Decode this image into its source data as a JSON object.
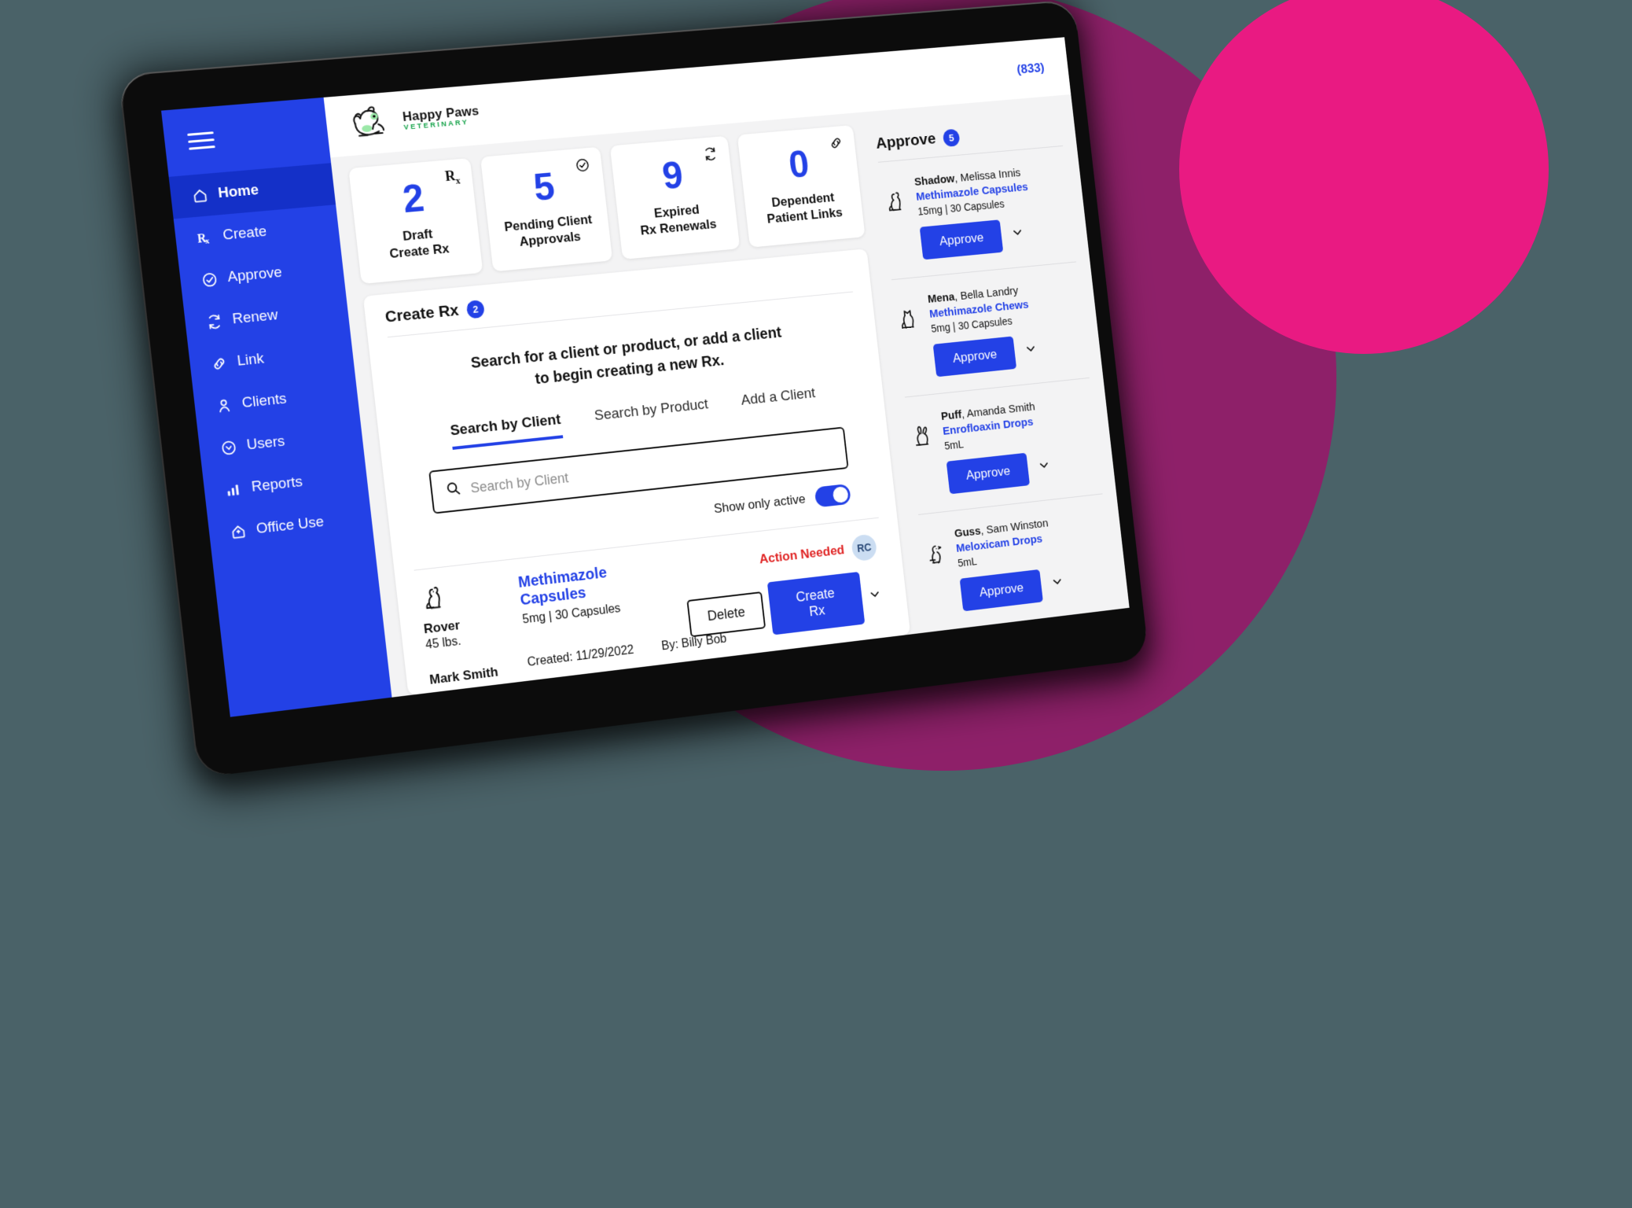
{
  "background": {
    "circle_purple": "#8E2069",
    "circle_pink": "#E91A82",
    "canvas": "#4A6268"
  },
  "brand": {
    "accent": "#2341E6",
    "name": "Happy Paws",
    "sub": "VETERINARY"
  },
  "topbar": {
    "phone": "(833)"
  },
  "sidebar": {
    "menu_icon": "hamburger-icon",
    "items": [
      {
        "label": "Home",
        "icon": "home-icon",
        "active": true
      },
      {
        "label": "Create",
        "icon": "rx-icon",
        "active": false
      },
      {
        "label": "Approve",
        "icon": "check-circle-icon",
        "active": false
      },
      {
        "label": "Renew",
        "icon": "refresh-icon",
        "active": false
      },
      {
        "label": "Link",
        "icon": "link-icon",
        "active": false
      },
      {
        "label": "Clients",
        "icon": "person-icon",
        "active": false
      },
      {
        "label": "Users",
        "icon": "user-circle-icon",
        "active": false
      },
      {
        "label": "Reports",
        "icon": "bar-chart-icon",
        "active": false
      },
      {
        "label": "Office Use",
        "icon": "office-icon",
        "active": false
      }
    ]
  },
  "stats": [
    {
      "value": "2",
      "label_1": "Draft",
      "label_2": "Create Rx",
      "icon": "rx-icon"
    },
    {
      "value": "5",
      "label_1": "Pending Client",
      "label_2": "Approvals",
      "icon": "check-circle-icon"
    },
    {
      "value": "9",
      "label_1": "Expired",
      "label_2": "Rx Renewals",
      "icon": "refresh-icon"
    },
    {
      "value": "0",
      "label_1": "Dependent",
      "label_2": "Patient Links",
      "icon": "link-icon"
    }
  ],
  "create_rx": {
    "title": "Create Rx",
    "count": "2",
    "prompt_line_1": "Search for a client or product, or add a client",
    "prompt_line_2": "to begin creating a new Rx.",
    "tabs": [
      {
        "label": "Search by Client",
        "active": true
      },
      {
        "label": "Search by Product",
        "active": false
      },
      {
        "label": "Add a Client",
        "active": false
      }
    ],
    "search": {
      "placeholder": "Search by Client",
      "value": "",
      "icon": "search-icon"
    },
    "toggle": {
      "label": "Show only active",
      "on": true
    },
    "row": {
      "pet_icon": "dog-icon",
      "pet_name": "Rover",
      "pet_weight": "45 lbs.",
      "owner": "Mark Smith",
      "product": "Methimazole Capsules",
      "dose": "5mg | 30 Capsules",
      "created": "Created: 11/29/2022",
      "by": "By: Billy Bob",
      "status": "Action Needed",
      "status_color": "#E02424",
      "avatar_initials": "RC",
      "delete_label": "Delete",
      "create_label": "Create Rx"
    }
  },
  "approve": {
    "title": "Approve",
    "count": "5",
    "button_label": "Approve",
    "items": [
      {
        "pet": "Shadow",
        "owner": "Melissa Innis",
        "product": "Methimazole Capsules",
        "dose": "15mg | 30 Capsules",
        "icon": "dog-icon"
      },
      {
        "pet": "Mena",
        "owner": "Bella Landry",
        "product": "Methimazole Chews",
        "dose": "5mg | 30 Capsules",
        "icon": "cat-icon"
      },
      {
        "pet": "Puff",
        "owner": "Amanda Smith",
        "product": "Enrofloaxin Drops",
        "dose": "5mL",
        "icon": "rabbit-icon"
      },
      {
        "pet": "Guss",
        "owner": "Sam Winston",
        "product": "Meloxicam Drops",
        "dose": "5mL",
        "icon": "bird-icon"
      }
    ]
  }
}
